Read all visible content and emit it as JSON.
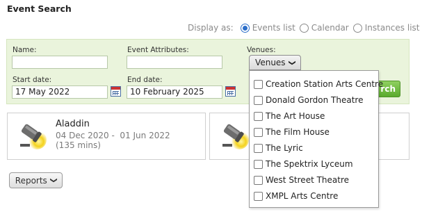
{
  "page": {
    "title": "Event Search"
  },
  "display": {
    "label": "Display as:",
    "options": [
      {
        "label": "Events list",
        "selected": true
      },
      {
        "label": "Calendar",
        "selected": false
      },
      {
        "label": "Instances list",
        "selected": false
      }
    ]
  },
  "filters": {
    "name": {
      "label": "Name:",
      "value": ""
    },
    "attributes": {
      "label": "Event Attributes:",
      "value": ""
    },
    "venues": {
      "label": "Venues:",
      "button_label": "Venues"
    },
    "start_date": {
      "label": "Start date:",
      "value": "17 May 2022"
    },
    "end_date": {
      "label": "End date:",
      "value": "10 February 2025"
    },
    "search_label": "rch"
  },
  "venue_options": [
    {
      "label": "Creation Station Arts Centre",
      "checked": false
    },
    {
      "label": "Donald Gordon Theatre",
      "checked": false
    },
    {
      "label": "The Art House",
      "checked": false
    },
    {
      "label": "The Film House",
      "checked": false
    },
    {
      "label": "The Lyric",
      "checked": false
    },
    {
      "label": "The Spektrix Lyceum",
      "checked": false
    },
    {
      "label": "West Street Theatre",
      "checked": false
    },
    {
      "label": "XMPL Arts Centre",
      "checked": false
    }
  ],
  "events": [
    {
      "title": "Aladdin",
      "dates": "04 Dec 2020 -  01 Jun 2022",
      "duration": "(135 mins)"
    }
  ],
  "reports": {
    "label": "Reports"
  },
  "colors": {
    "panel_bg": "#eaf4dc",
    "accent": "#2c6ec9",
    "search_green": "#5aaa2e"
  }
}
